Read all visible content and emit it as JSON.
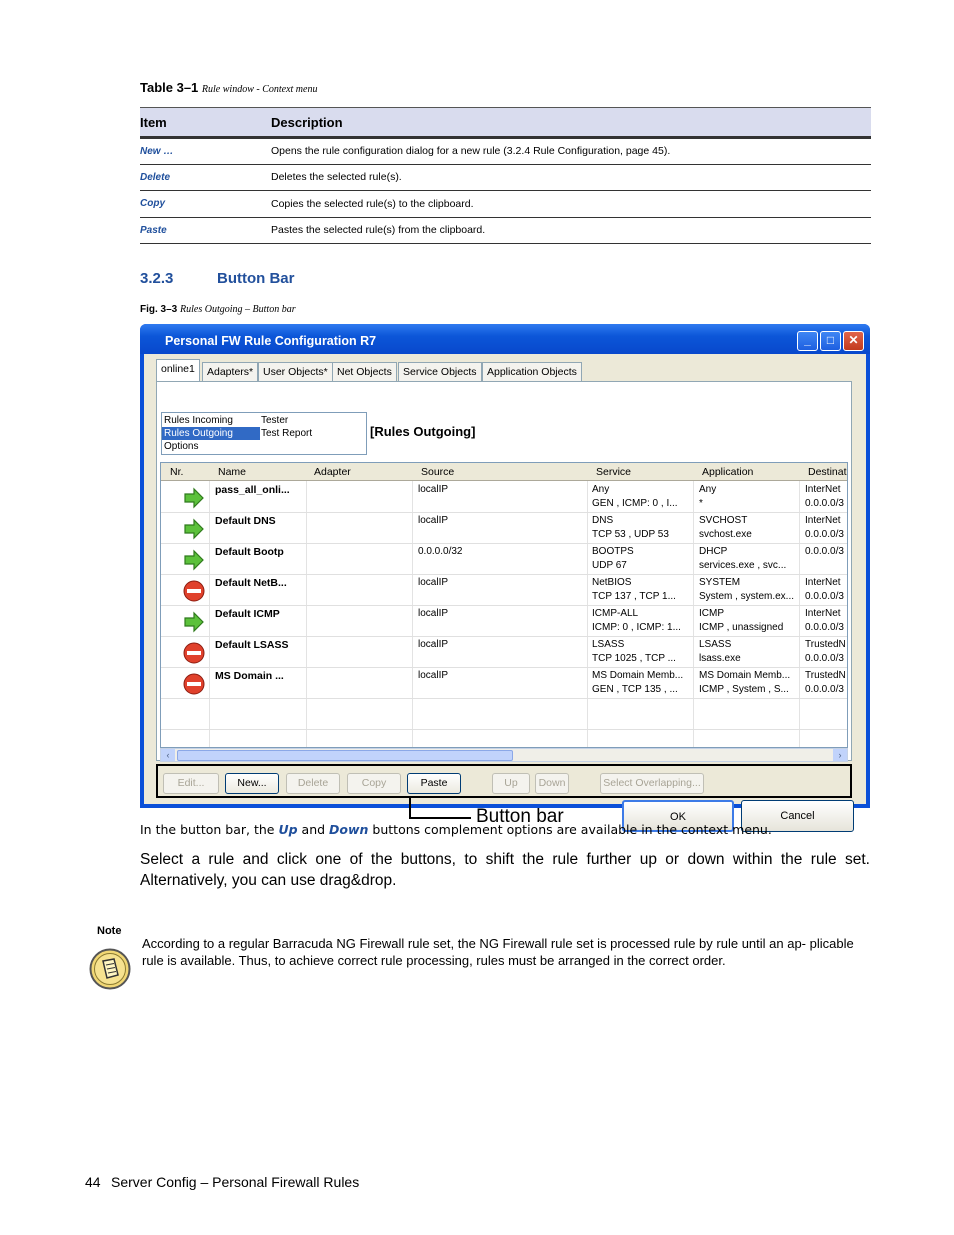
{
  "table": {
    "caption_label": "Table 3–1",
    "caption_text": "Rule window - Context menu",
    "headers": [
      "Item",
      "Description"
    ],
    "rows": [
      {
        "item": "New …",
        "desc": "Opens the rule configuration dialog for a new rule (3.2.4 Rule Configuration, page 45)."
      },
      {
        "item": "Delete",
        "desc": "Deletes the selected rule(s)."
      },
      {
        "item": "Copy",
        "desc": "Copies the selected rule(s) to the clipboard."
      },
      {
        "item": "Paste",
        "desc": "Pastes the selected rule(s) from the clipboard."
      }
    ]
  },
  "section": {
    "number": "3.2.3",
    "title": "Button Bar"
  },
  "figure": {
    "label": "Fig. 3–3",
    "caption": "Rules Outgoing – Button bar"
  },
  "window": {
    "title": "Personal FW Rule Configuration R7",
    "tabs": [
      "online1",
      "Adapters*",
      "User Objects*",
      "Net Objects",
      "Service Objects",
      "Application Objects"
    ],
    "nav_list": {
      "col1": [
        "Rules Incoming",
        "Rules Outgoing",
        "Options"
      ],
      "col2": [
        "Tester",
        "Test Report"
      ]
    },
    "rules_label": "[Rules Outgoing]",
    "columns": [
      "Nr.",
      "Name",
      "Adapter",
      "Source",
      "Service",
      "Application",
      "Destinat"
    ],
    "rows": [
      {
        "icon": "allow",
        "name": "pass_all_onli...",
        "adapter": "",
        "source": "localIP",
        "service1": "Any",
        "service2": "GEN , ICMP: 0 , I...",
        "app1": "Any",
        "app2": "*",
        "dest1": "InterNet",
        "dest2": "0.0.0.0/3"
      },
      {
        "icon": "allow",
        "name": "Default DNS",
        "adapter": "",
        "source": "localIP",
        "service1": "DNS",
        "service2": "TCP 53 , UDP 53",
        "app1": "SVCHOST",
        "app2": "svchost.exe",
        "dest1": "InterNet",
        "dest2": "0.0.0.0/3"
      },
      {
        "icon": "allow",
        "name": "Default Bootp",
        "adapter": "",
        "source": "0.0.0.0/32",
        "service1": "BOOTPS",
        "service2": "UDP 67",
        "app1": "DHCP",
        "app2": "services.exe , svc...",
        "dest1": "0.0.0.0/3",
        "dest2": ""
      },
      {
        "icon": "block",
        "name": "Default NetB...",
        "adapter": "",
        "source": "localIP",
        "service1": "NetBIOS",
        "service2": "TCP 137 , TCP 1...",
        "app1": "SYSTEM",
        "app2": "System , system.ex...",
        "dest1": "InterNet",
        "dest2": "0.0.0.0/3"
      },
      {
        "icon": "allow",
        "name": "Default ICMP",
        "adapter": "",
        "source": "localIP",
        "service1": "ICMP-ALL",
        "service2": "ICMP: 0 , ICMP: 1...",
        "app1": "ICMP",
        "app2": "ICMP , unassigned",
        "dest1": "InterNet",
        "dest2": "0.0.0.0/3"
      },
      {
        "icon": "block",
        "name": "Default LSASS",
        "adapter": "",
        "source": "localIP",
        "service1": "LSASS",
        "service2": "TCP 1025 , TCP ...",
        "app1": "LSASS",
        "app2": "lsass.exe",
        "dest1": "TrustedN",
        "dest2": "0.0.0.0/3"
      },
      {
        "icon": "block",
        "name": "MS Domain ...",
        "adapter": "",
        "source": "localIP",
        "service1": "MS Domain Memb...",
        "service2": "GEN , TCP 135 , ...",
        "app1": "MS Domain Memb...",
        "app2": "ICMP , System , S...",
        "dest1": "TrustedN",
        "dest2": "0.0.0.0/3"
      }
    ],
    "buttons": [
      {
        "label": "Edit...",
        "enabled": false
      },
      {
        "label": "New...",
        "enabled": true
      },
      {
        "label": "Delete",
        "enabled": false
      },
      {
        "label": "Copy",
        "enabled": false
      },
      {
        "label": "Paste",
        "enabled": true
      },
      {
        "label": "Up",
        "enabled": false
      },
      {
        "label": "Down",
        "enabled": false
      },
      {
        "label": "Select Overlapping...",
        "enabled": false
      }
    ],
    "callout": "Button bar",
    "ok": "OK",
    "cancel": "Cancel"
  },
  "para1": {
    "pre": "In the button bar, the ",
    "up": "Up",
    "mid": " and ",
    "down": "Down",
    "post": " buttons complement options are available in the context menu."
  },
  "para2": "Select a rule and click one of the buttons, to shift the rule further up or down within the rule set. Alternatively, you can use drag&drop.",
  "note": {
    "label": "Note",
    "text": "According to a regular Barracuda NG Firewall rule set, the NG Firewall rule set is processed rule by rule until an ap- plicable rule is available. Thus, to achieve correct rule processing, rules must be arranged in the correct order."
  },
  "footer": {
    "page": "44",
    "text": "Server Config – Personal Firewall Rules"
  }
}
